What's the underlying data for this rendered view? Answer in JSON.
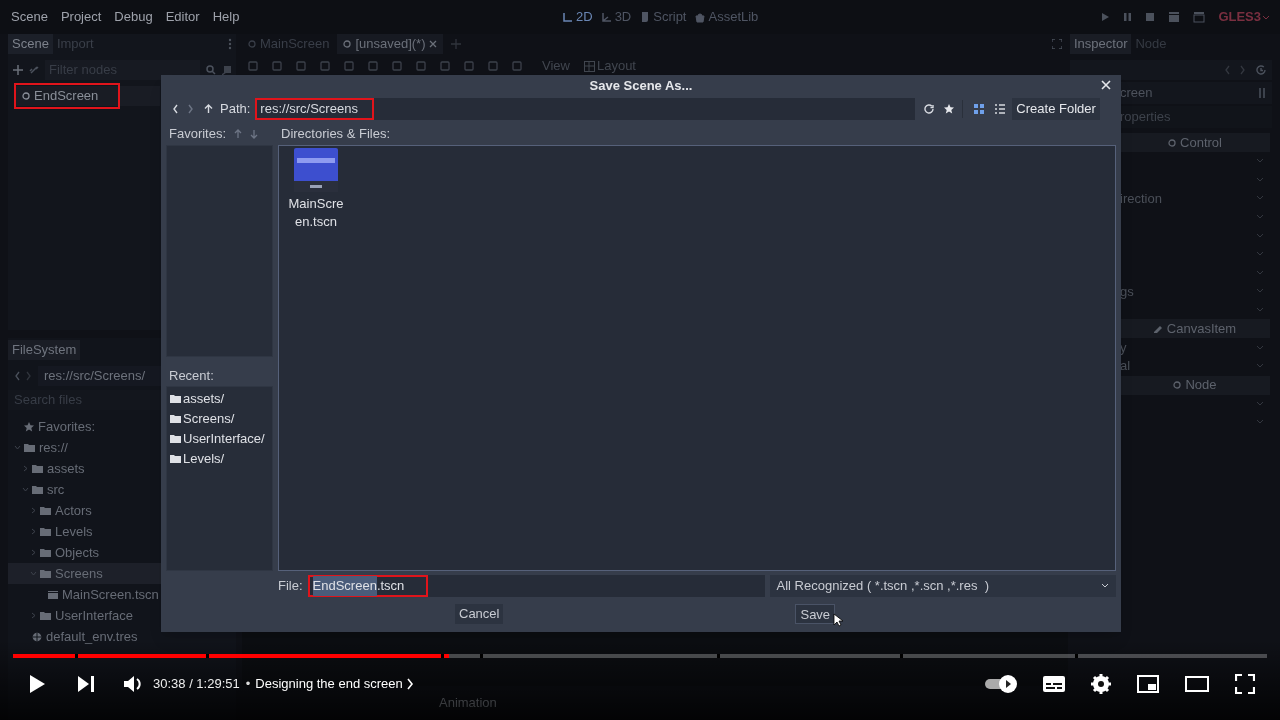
{
  "menu": [
    "Scene",
    "Project",
    "Debug",
    "Editor",
    "Help"
  ],
  "workspaces": [
    {
      "label": "2D",
      "kind": "twod",
      "selected": true
    },
    {
      "label": "3D",
      "kind": "threed",
      "selected": false
    },
    {
      "label": "Script",
      "kind": "script",
      "selected": false
    },
    {
      "label": "AssetLib",
      "kind": "assetlib",
      "selected": false
    }
  ],
  "renderer": "GLES3",
  "scene_dock": {
    "tabs": [
      {
        "label": "Scene",
        "selected": true
      },
      {
        "label": "Import",
        "selected": false
      }
    ],
    "filter_placeholder": "Filter nodes",
    "nodes": [
      {
        "label": "EndScreen",
        "highlighted": true
      }
    ]
  },
  "editor_tabs": [
    {
      "label": "MainScreen",
      "selected": false
    },
    {
      "label": "[unsaved](*)",
      "selected": true
    }
  ],
  "toolbar": {
    "view": "View",
    "layout": "Layout"
  },
  "inspector": {
    "tabs": [
      {
        "label": "Inspector",
        "selected": true
      },
      {
        "label": "Node",
        "selected": false
      }
    ],
    "object_name": "creen",
    "filter": "roperties",
    "rows": [
      {
        "kind": "classheader",
        "label": "Control"
      },
      {
        "kind": "row"
      },
      {
        "kind": "row"
      },
      {
        "kind": "row",
        "label": "irection"
      },
      {
        "kind": "row"
      },
      {
        "kind": "row"
      },
      {
        "kind": "row"
      },
      {
        "kind": "row"
      },
      {
        "kind": "row",
        "label": "gs"
      },
      {
        "kind": "row"
      },
      {
        "kind": "canvasheader",
        "label": "CanvasItem"
      },
      {
        "kind": "row",
        "label": "y"
      },
      {
        "kind": "row",
        "label": "al"
      },
      {
        "kind": "classheader",
        "label": "Node"
      },
      {
        "kind": "row"
      },
      {
        "kind": "row"
      }
    ]
  },
  "filesystem": {
    "title": "FileSystem",
    "path": "res://src/Screens/",
    "search_placeholder": "Search files",
    "tree": [
      {
        "label": "Favorites:",
        "kind": "favorites",
        "selected": false
      },
      {
        "label": "res://",
        "kind": "folder",
        "expanded": true,
        "selected": false,
        "children": [
          {
            "label": "assets",
            "kind": "folder",
            "expanded": false,
            "selected": false
          },
          {
            "label": "src",
            "kind": "folder",
            "expanded": true,
            "selected": false,
            "children": [
              {
                "label": "Actors",
                "kind": "folder",
                "expanded": false,
                "selected": false
              },
              {
                "label": "Levels",
                "kind": "folder",
                "expanded": false,
                "selected": false
              },
              {
                "label": "Objects",
                "kind": "folder",
                "expanded": false,
                "selected": false
              },
              {
                "label": "Screens",
                "kind": "folder",
                "expanded": true,
                "selected": true,
                "children": [
                  {
                    "label": "MainScreen.tscn",
                    "kind": "scene",
                    "selected": false
                  }
                ]
              },
              {
                "label": "UserInterface",
                "kind": "folder",
                "expanded": false,
                "selected": false
              }
            ]
          },
          {
            "label": "default_env.tres",
            "kind": "resource",
            "selected": false
          }
        ]
      }
    ]
  },
  "bottom_tabs": [
    "Animation"
  ],
  "dialog": {
    "title": "Save Scene As...",
    "path_label": "Path:",
    "path": "res://src/Screens",
    "path_highlighted": true,
    "view_modes": [
      {
        "kind": "grid",
        "selected": true
      },
      {
        "kind": "list",
        "selected": false
      }
    ],
    "create_folder": "Create Folder",
    "favorites_label": "Favorites:",
    "files_label": "Directories & Files:",
    "files": [
      {
        "label": "MainScreen.tscn",
        "kind": "picture"
      }
    ],
    "recent_label": "Recent:",
    "recent": [
      "assets/",
      "Screens/",
      "UserInterface/",
      "Levels/"
    ],
    "file_label": "File:",
    "file_highlighted": true,
    "file_name_parts": [
      {
        "text": "EndScreen",
        "selected": true
      },
      {
        "text": ".tscn",
        "selected": false
      }
    ],
    "filter": "All Recognized ( *.tscn ,*.scn ,*.res  )",
    "cancel": "Cancel",
    "save": "Save"
  },
  "player": {
    "progress": {
      "level": 0.348
    },
    "time": "30:38 / 1:29:51",
    "separator": "•",
    "chapter": "Designing the end screen",
    "autoplay": true
  }
}
